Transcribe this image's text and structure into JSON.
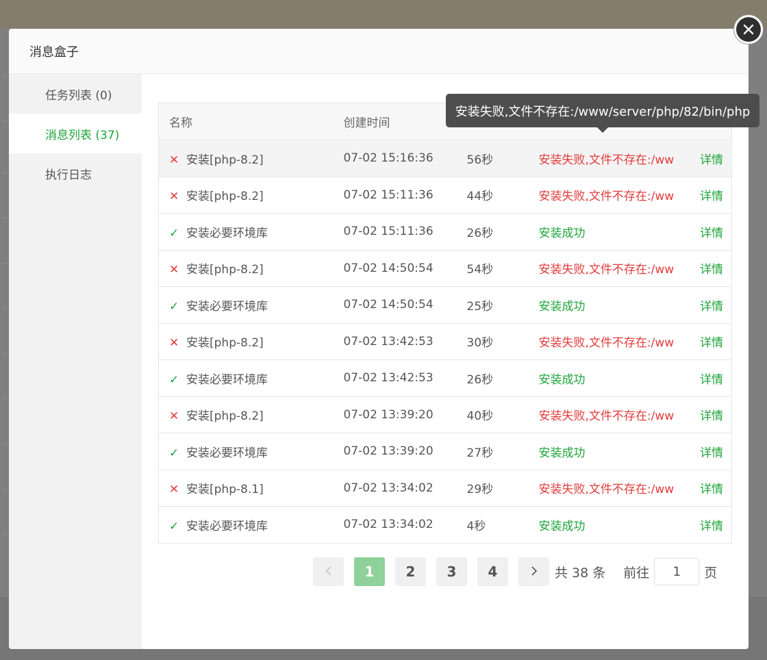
{
  "dialog": {
    "title": "消息盒子"
  },
  "sidebar": {
    "items": [
      {
        "label": "任务列表 (0)",
        "active": false
      },
      {
        "label": "消息列表 (37)",
        "active": true
      },
      {
        "label": "执行日志",
        "active": false
      }
    ]
  },
  "table": {
    "headers": {
      "name": "名称",
      "created": "创建时间"
    },
    "rows": [
      {
        "status": "fail",
        "name": "安装[php-8.2]",
        "created": "07-02 15:16:36",
        "duration": "56秒",
        "result": "安装失败,文件不存在:/ww",
        "detail": "详情"
      },
      {
        "status": "fail",
        "name": "安装[php-8.2]",
        "created": "07-02 15:11:36",
        "duration": "44秒",
        "result": "安装失败,文件不存在:/ww",
        "detail": "详情"
      },
      {
        "status": "ok",
        "name": "安装必要环境库",
        "created": "07-02 15:11:36",
        "duration": "26秒",
        "result": "安装成功",
        "detail": "详情"
      },
      {
        "status": "fail",
        "name": "安装[php-8.2]",
        "created": "07-02 14:50:54",
        "duration": "54秒",
        "result": "安装失败,文件不存在:/ww",
        "detail": "详情"
      },
      {
        "status": "ok",
        "name": "安装必要环境库",
        "created": "07-02 14:50:54",
        "duration": "25秒",
        "result": "安装成功",
        "detail": "详情"
      },
      {
        "status": "fail",
        "name": "安装[php-8.2]",
        "created": "07-02 13:42:53",
        "duration": "30秒",
        "result": "安装失败,文件不存在:/ww",
        "detail": "详情"
      },
      {
        "status": "ok",
        "name": "安装必要环境库",
        "created": "07-02 13:42:53",
        "duration": "26秒",
        "result": "安装成功",
        "detail": "详情"
      },
      {
        "status": "fail",
        "name": "安装[php-8.2]",
        "created": "07-02 13:39:20",
        "duration": "40秒",
        "result": "安装失败,文件不存在:/ww",
        "detail": "详情"
      },
      {
        "status": "ok",
        "name": "安装必要环境库",
        "created": "07-02 13:39:20",
        "duration": "27秒",
        "result": "安装成功",
        "detail": "详情"
      },
      {
        "status": "fail",
        "name": "安装[php-8.1]",
        "created": "07-02 13:34:02",
        "duration": "29秒",
        "result": "安装失败,文件不存在:/ww",
        "detail": "详情"
      },
      {
        "status": "ok",
        "name": "安装必要环境库",
        "created": "07-02 13:34:02",
        "duration": "4秒",
        "result": "安装成功",
        "detail": "详情"
      }
    ]
  },
  "tooltip": {
    "text": "安装失败,文件不存在:/www/server/php/82/bin/php"
  },
  "pagination": {
    "prev_icon": "chevron-left-icon",
    "pages": [
      "1",
      "2",
      "3",
      "4"
    ],
    "current": "1",
    "next_icon": "chevron-right-icon",
    "total": "共 38 条",
    "goto_label": "前往",
    "goto_value": "1",
    "page_suffix": "页"
  },
  "colors": {
    "accent": "#20a53a",
    "error": "#e23b3b"
  }
}
